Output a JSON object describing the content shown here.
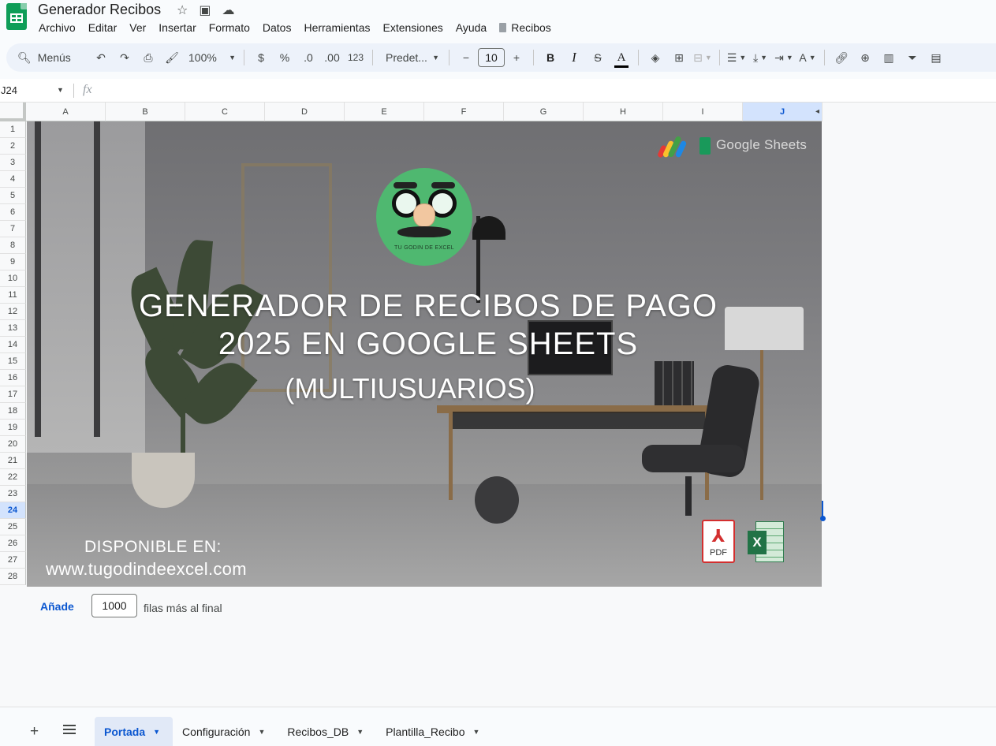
{
  "app": {
    "doc_title": "Generador Recibos",
    "menu": [
      "Archivo",
      "Editar",
      "Ver",
      "Insertar",
      "Formato",
      "Datos",
      "Herramientas",
      "Extensiones",
      "Ayuda"
    ],
    "menu_extra": "Recibos"
  },
  "toolbar": {
    "search_label": "Menús",
    "zoom": "100%",
    "currency": "$",
    "percent": "%",
    "dec_decrease": ".0",
    "dec_increase": ".00",
    "number_format": "123",
    "font": "Predet...",
    "font_size": "10",
    "bold": "B",
    "italic": "I",
    "strike": "S",
    "text_color": "A"
  },
  "formula_bar": {
    "cell_ref": "J24",
    "fx": "fx"
  },
  "grid": {
    "columns": [
      "A",
      "B",
      "C",
      "D",
      "E",
      "F",
      "G",
      "H",
      "I",
      "J"
    ],
    "active_column": "J",
    "rows": [
      "1",
      "2",
      "3",
      "4",
      "5",
      "6",
      "7",
      "8",
      "9",
      "10",
      "11",
      "12",
      "13",
      "14",
      "15",
      "16",
      "17",
      "18",
      "19",
      "20",
      "21",
      "22",
      "23",
      "24",
      "25",
      "26",
      "27",
      "28"
    ],
    "active_row": "24"
  },
  "banner": {
    "brand_text": "Google Sheets",
    "mascot_label": "TU GODIN DE EXCEL",
    "title_line1": "GENERADOR DE RECIBOS DE PAGO",
    "title_line2": "2025 EN GOOGLE SHEETS",
    "subtitle": "(MULTIUSUARIOS)",
    "available": "DISPONIBLE EN:",
    "website": "www.tugodindeexcel.com",
    "pdf_label": "PDF",
    "excel_label": "X"
  },
  "add_rows": {
    "button": "Añade",
    "count": "1000",
    "suffix": "filas más al final"
  },
  "sheets": {
    "add": "+",
    "tabs": [
      "Portada",
      "Configuración",
      "Recibos_DB",
      "Plantilla_Recibo"
    ],
    "active": "Portada"
  }
}
